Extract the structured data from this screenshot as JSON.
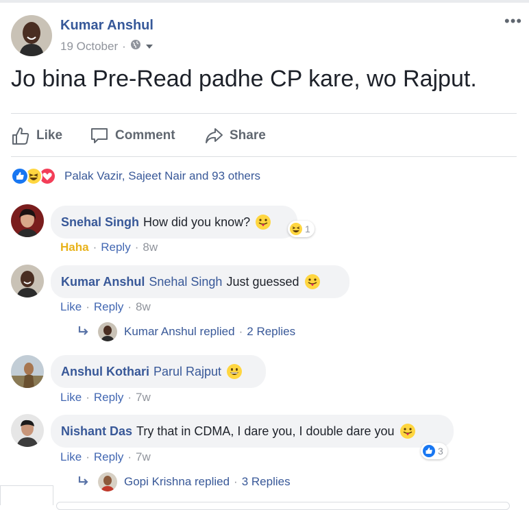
{
  "post": {
    "author": "Kumar Anshul",
    "date": "19 October",
    "separator": "·",
    "more": "•••",
    "text": "Jo bina Pre-Read padhe CP kare, wo Rajput."
  },
  "actions": {
    "like": "Like",
    "comment": "Comment",
    "share": "Share"
  },
  "reactions": {
    "icons": [
      "like-reaction-icon",
      "haha-reaction-icon",
      "love-reaction-icon"
    ],
    "names": "Palak Vazir, Sajeet Nair and 93 others"
  },
  "comments": [
    {
      "name": "Snehal Singh",
      "text": "How did you know?",
      "badge_count": "1",
      "reaction_label": "Haha",
      "reply": "Reply",
      "time": "8w",
      "sep": "·"
    },
    {
      "name": "Kumar Anshul",
      "mention": "Snehal Singh",
      "text": "Just guessed",
      "like": "Like",
      "reply": "Reply",
      "time": "8w",
      "sep": "·",
      "replies": {
        "who": "Kumar Anshul replied",
        "sep": "·",
        "count": "2 Replies"
      }
    },
    {
      "name": "Anshul Kothari",
      "mention": "Parul Rajput",
      "like": "Like",
      "reply": "Reply",
      "time": "7w",
      "sep": "·"
    },
    {
      "name": "Nishant Das",
      "text": "Try that in CDMA, I dare you, I double dare you",
      "badge_count": "3",
      "like": "Like",
      "reply": "Reply",
      "time": "7w",
      "sep": "·",
      "replies": {
        "who": "Gopi Krishna replied",
        "sep": "·",
        "count": "3 Replies"
      }
    }
  ],
  "colors": {
    "link": "#385898",
    "meta": "#90949c",
    "haha": "#e8b21a",
    "like_blue": "#1877f2",
    "love_red": "#f33e58"
  }
}
